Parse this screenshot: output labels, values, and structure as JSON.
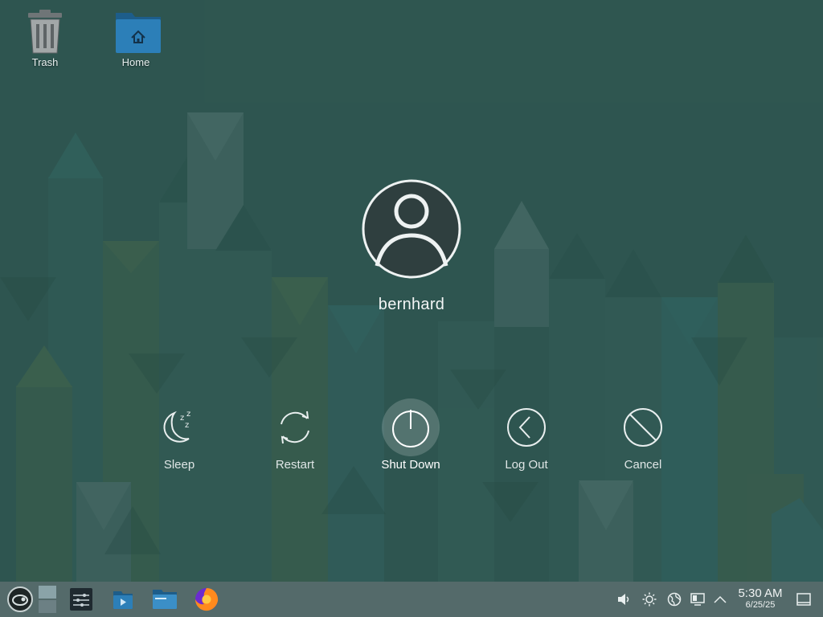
{
  "desktop": {
    "icons": [
      {
        "label": "Trash",
        "icon": "trash-icon"
      },
      {
        "label": "Home",
        "icon": "home-folder-icon"
      }
    ]
  },
  "logout_dialog": {
    "username": "bernhard",
    "actions": [
      {
        "label": "Sleep",
        "icon": "sleep-moon-icon",
        "selected": false
      },
      {
        "label": "Restart",
        "icon": "restart-icon",
        "selected": false
      },
      {
        "label": "Shut Down",
        "icon": "power-icon",
        "selected": true
      },
      {
        "label": "Log Out",
        "icon": "logout-arrow-icon",
        "selected": false
      },
      {
        "label": "Cancel",
        "icon": "cancel-icon",
        "selected": false
      }
    ]
  },
  "taskbar": {
    "launcher_icon": "opensuse-launcher-icon",
    "apps": [
      "pager-icon",
      "system-settings-icon",
      "discover-icon",
      "file-manager-icon",
      "firefox-icon"
    ],
    "tray": [
      "volume-icon",
      "brightness-icon",
      "network-globe-icon",
      "display-icon",
      "expand-tray-icon"
    ],
    "clock": {
      "time": "5:30 AM",
      "date": "6/25/25"
    },
    "show_desktop_icon": "show-desktop-icon"
  },
  "colors": {
    "background": "#335f58",
    "taskbar": "#546a6a",
    "avatar_fill": "#2f3f3f"
  }
}
